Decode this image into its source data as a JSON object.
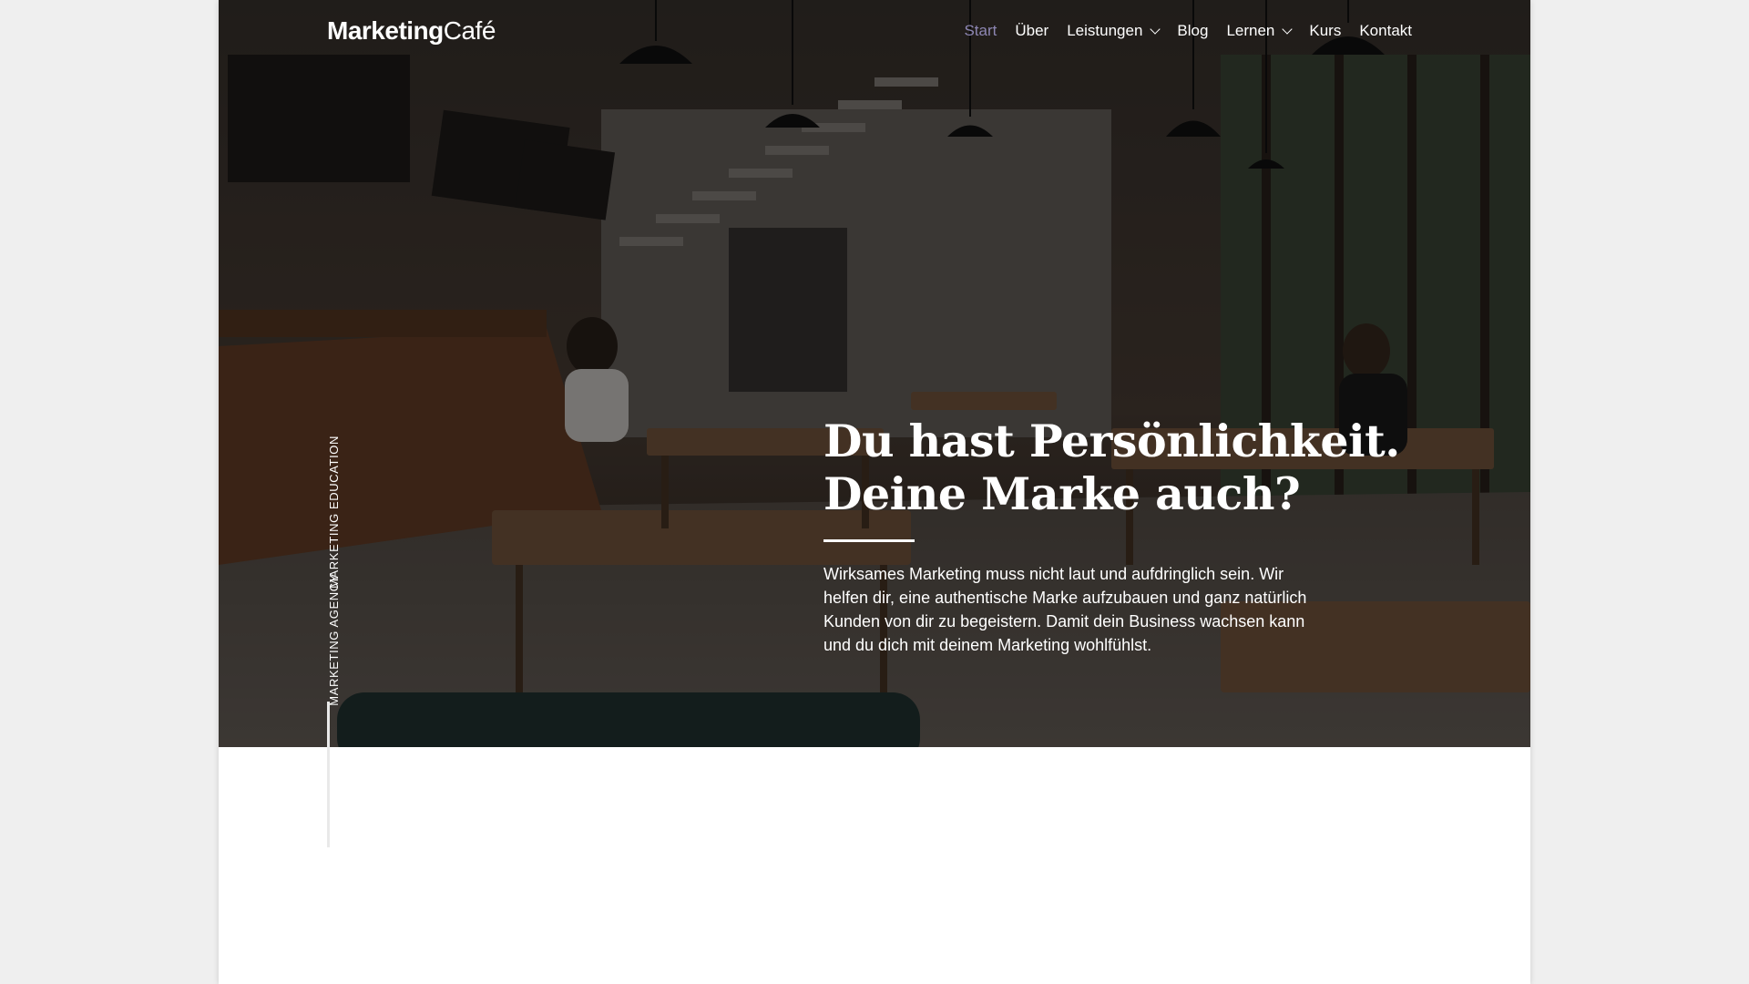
{
  "brand": {
    "logo_bold": "Marketing",
    "logo_light": "Café"
  },
  "nav": {
    "items": [
      {
        "label": "Start",
        "active": true,
        "dropdown": false
      },
      {
        "label": "Über",
        "active": false,
        "dropdown": false
      },
      {
        "label": "Leistungen",
        "active": false,
        "dropdown": true
      },
      {
        "label": "Blog",
        "active": false,
        "dropdown": false
      },
      {
        "label": "Lernen",
        "active": false,
        "dropdown": true
      },
      {
        "label": "Kurs",
        "active": false,
        "dropdown": false
      },
      {
        "label": "Kontakt",
        "active": false,
        "dropdown": false
      }
    ]
  },
  "side": {
    "education": "MARKETING EDUCATION",
    "agency": "MARKETING AGENCY"
  },
  "hero": {
    "headline_line1": "Du hast Persönlichkeit.",
    "headline_line2": "Deine Marke auch?",
    "lead": "Wirksames Marketing muss nicht laut und aufdringlich sein. Wir helfen dir, eine authentische Marke aufzubauen und ganz natürlich Kunden von dir zu begeistern. Damit dein Business wachsen kann und du dich mit deinem Marketing wohlfühlst."
  },
  "colors": {
    "active_nav": "#8d86b3",
    "background": "#efefef",
    "page": "#ffffff"
  }
}
